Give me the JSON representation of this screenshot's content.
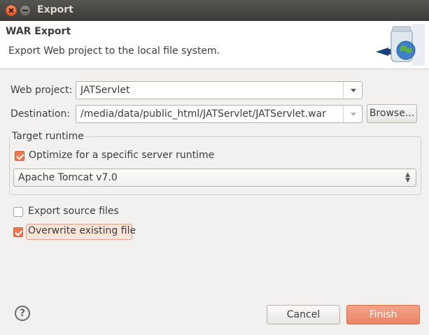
{
  "window": {
    "title": "Export"
  },
  "header": {
    "title": "WAR Export",
    "description": "Export Web project to the local file system."
  },
  "form": {
    "web_project_label": "Web project:",
    "web_project_value": "JATServlet",
    "destination_label": "Destination:",
    "destination_value": "/media/data/public_html/JATServlet/JATServlet.war",
    "browse_label": "Browse..."
  },
  "target_runtime": {
    "group_label": "Target runtime",
    "optimize_label": "Optimize for a specific server runtime",
    "optimize_checked": true,
    "runtime_value": "Apache Tomcat v7.0"
  },
  "options": {
    "export_source_label": "Export source files",
    "export_source_checked": false,
    "overwrite_label": "Overwrite existing file",
    "overwrite_checked": true
  },
  "footer": {
    "help_glyph": "?",
    "cancel_label": "Cancel",
    "finish_label": "Finish"
  },
  "colors": {
    "accent": "#ef7a52",
    "primary_button": "#ea8466",
    "titlebar": "#3d3c38"
  },
  "icons": [
    "close-icon",
    "minimize-icon",
    "export-wizard-icon",
    "dropdown-arrow-icon",
    "updown-arrows-icon",
    "help-icon",
    "checkmark-icon"
  ]
}
